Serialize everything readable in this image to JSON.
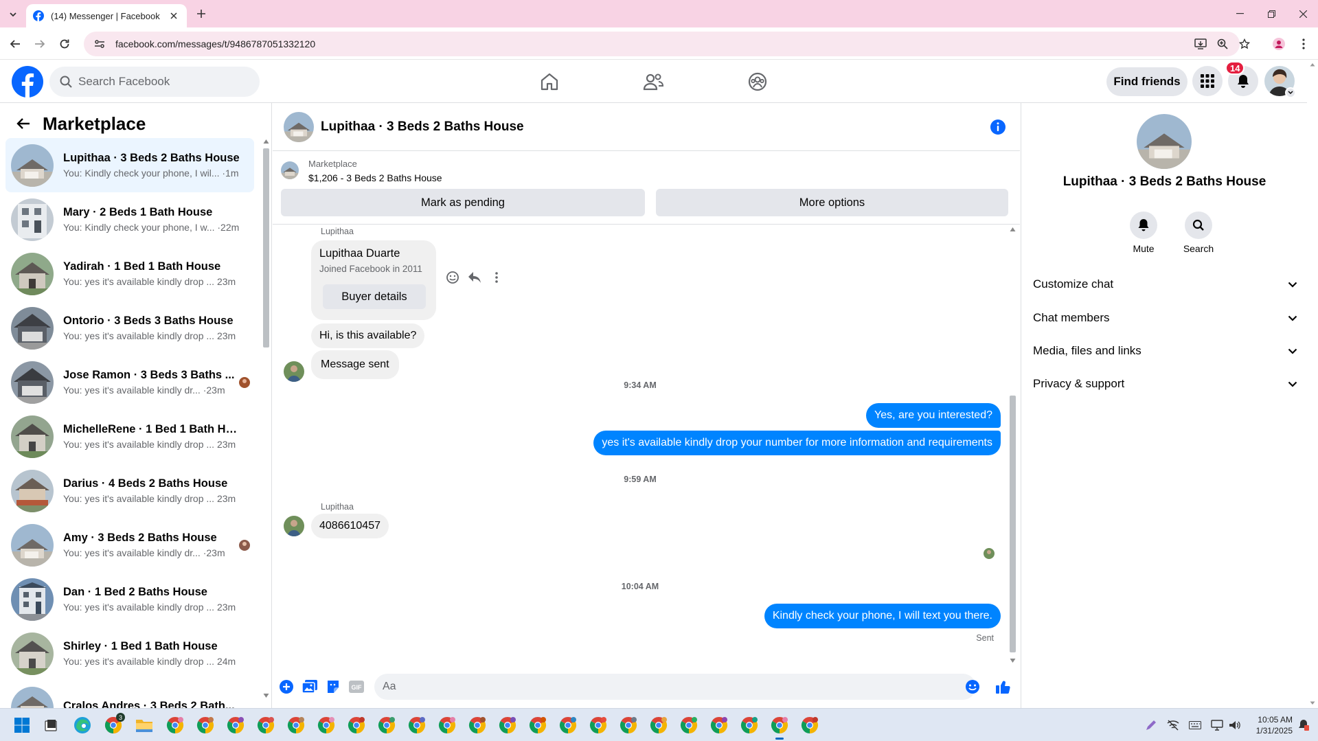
{
  "browser": {
    "tab_title": "(14) Messenger | Facebook",
    "url": "facebook.com/messages/t/9486787051332120"
  },
  "fbnav": {
    "search_placeholder": "Search Facebook",
    "find_friends": "Find friends",
    "notif_count": "14",
    "brand_color": "#0866ff"
  },
  "sidebar": {
    "title": "Marketplace",
    "conversations": [
      {
        "name": "Lupithaa · 3 Beds 2 Baths House",
        "preview": "You: Kindly check your phone, I wil... ·1m",
        "active": true
      },
      {
        "name": "Mary · 2 Beds 1 Bath House",
        "preview": "You: Kindly check your phone, I w... ·22m"
      },
      {
        "name": "Yadirah · 1 Bed 1 Bath House",
        "preview": "You: yes it's available kindly drop ... 23m"
      },
      {
        "name": "Ontorio · 3 Beds 3 Baths House",
        "preview": "You: yes it's available kindly drop ... 23m"
      },
      {
        "name": "Jose Ramon · 3 Beds 3 Baths ...",
        "preview": "You: yes it's available kindly dr... ·23m"
      },
      {
        "name": "MichelleRene · 1 Bed 1 Bath House",
        "preview": "You: yes it's available kindly drop ... 23m"
      },
      {
        "name": "Darius · 4 Beds 2 Baths House",
        "preview": "You: yes it's available kindly drop ... 23m"
      },
      {
        "name": "Amy · 3 Beds 2 Baths House",
        "preview": "You: yes it's available kindly dr... ·23m"
      },
      {
        "name": "Dan · 1 Bed 2 Baths House",
        "preview": "You: yes it's available kindly drop ... 23m"
      },
      {
        "name": "Shirley · 1 Bed 1 Bath House",
        "preview": "You: yes it's available kindly drop ... 24m"
      },
      {
        "name": "Cralos Andres · 3 Beds 2 Bath...",
        "preview": ""
      }
    ]
  },
  "chat": {
    "title": "Lupithaa · 3 Beds 2 Baths House",
    "marketplace_label": "Marketplace",
    "listing": "$1,206 - 3 Beds 2 Baths House",
    "mark_pending": "Mark as pending",
    "more_options": "More options",
    "sender_label": "Lupithaa",
    "buyer_name": "Lupithaa Duarte",
    "buyer_joined": "Joined Facebook in 2011",
    "buyer_details": "Buyer details",
    "msg_available": "Hi, is this available?",
    "msg_sent": "Message sent",
    "time1": "9:34 AM",
    "out1": "Yes, are you interested?",
    "out2": "yes it's available kindly drop your number for more information and requirements",
    "time2": "9:59 AM",
    "sender_label2": "Lupithaa",
    "in_phone": "4086610457",
    "time3": "10:04 AM",
    "out3": "Kindly check your phone, I will text you there.",
    "sent_status": "Sent",
    "composer_placeholder": "Aa",
    "accent": "#0084ff"
  },
  "rpanel": {
    "name": "Lupithaa · 3 Beds 2 Baths House",
    "mute": "Mute",
    "search": "Search",
    "rows": [
      "Customize chat",
      "Chat members",
      "Media, files and links",
      "Privacy & support"
    ]
  },
  "taskbar": {
    "time": "10:05 AM",
    "date": "1/31/2025",
    "chrome_badge": "3"
  }
}
